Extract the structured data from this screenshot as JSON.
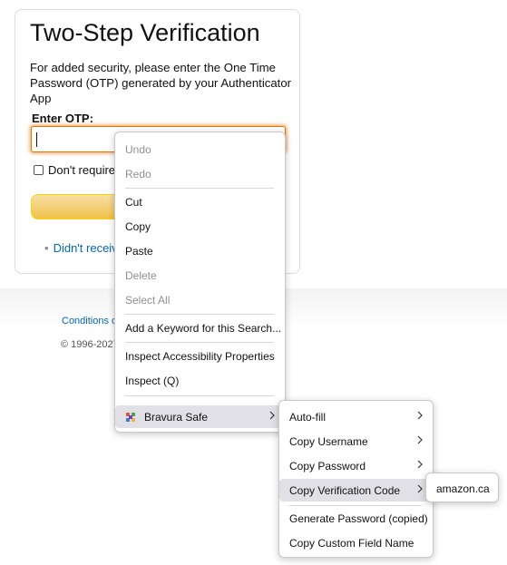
{
  "page": {
    "title": "Two-Step Verification",
    "description": "For added security, please enter the One Time Password (OTP) generated by your Authenticator App",
    "otp_label": "Enter OTP:",
    "otp_value": "",
    "remember_label": "Don't require",
    "didnt_receive": "Didn't receive",
    "footer_conditions": "Conditions o",
    "footer_copyright": "© 1996-2027"
  },
  "context_menu": {
    "items": [
      {
        "label": "Undo",
        "underline": "U",
        "disabled": true
      },
      {
        "label": "Redo",
        "underline": "R",
        "disabled": true
      },
      {
        "label": "Cut",
        "underline": "t",
        "disabled": false
      },
      {
        "label": "Copy",
        "underline": "C",
        "disabled": false
      },
      {
        "label": "Paste",
        "underline": "P",
        "disabled": false
      },
      {
        "label": "Delete",
        "underline": "D",
        "disabled": true
      },
      {
        "label": "Select All",
        "underline": "A",
        "disabled": true
      },
      {
        "label": "Add a Keyword for this Search...",
        "underline": "K",
        "disabled": false
      },
      {
        "label": "Inspect Accessibility Properties",
        "disabled": false
      },
      {
        "label": "Inspect (Q)",
        "disabled": false
      },
      {
        "label": "Bravura Safe",
        "disabled": false
      }
    ]
  },
  "bravura_menu": {
    "items": [
      {
        "label": "Auto-fill"
      },
      {
        "label": "Copy Username"
      },
      {
        "label": "Copy Password"
      },
      {
        "label": "Copy Verification Code"
      },
      {
        "label": "Generate Password (copied)"
      },
      {
        "label": "Copy Custom Field Name"
      }
    ]
  },
  "verification_submenu": {
    "items": [
      {
        "label": "amazon.ca"
      }
    ]
  },
  "colors": {
    "accent": "#e77600",
    "link": "#0066c0",
    "menu_highlight": "#e0e0e6",
    "button": "#f0c14b"
  }
}
